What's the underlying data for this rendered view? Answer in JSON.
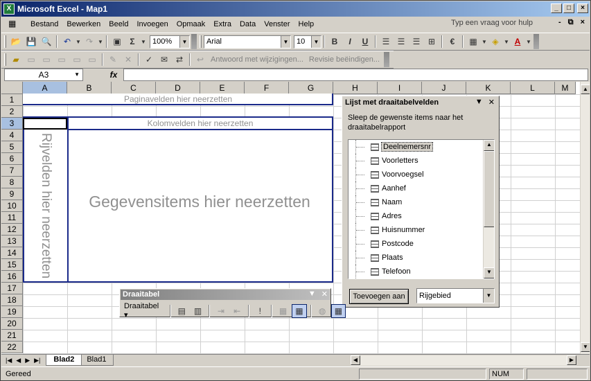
{
  "window": {
    "title": "Microsoft Excel - Map1",
    "minimize": "_",
    "maximize": "□",
    "close": "×"
  },
  "menu": {
    "items": [
      "Bestand",
      "Bewerken",
      "Beeld",
      "Invoegen",
      "Opmaak",
      "Extra",
      "Data",
      "Venster",
      "Help"
    ],
    "ask_placeholder": "Typ een vraag voor hulp"
  },
  "toolbar": {
    "zoom": "100%",
    "font": "Arial",
    "font_size": "10",
    "bold": "B",
    "italic": "I",
    "underline": "U",
    "euro": "€",
    "reply_with_changes": "Antwoord met wijzigingen...",
    "end_review": "Revisie beëindigen..."
  },
  "formula": {
    "namebox": "A3",
    "fx": "fx",
    "value": ""
  },
  "grid": {
    "columns": [
      "A",
      "B",
      "C",
      "D",
      "E",
      "F",
      "G",
      "H",
      "I",
      "J",
      "K",
      "L",
      "M"
    ],
    "rows": [
      "1",
      "2",
      "3",
      "4",
      "5",
      "6",
      "7",
      "8",
      "9",
      "10",
      "11",
      "12",
      "13",
      "14",
      "15",
      "16",
      "17",
      "18",
      "19",
      "20",
      "21",
      "22"
    ],
    "selected_column": "A",
    "selected_row": "3"
  },
  "pivot_layout": {
    "page_fields": "Paginavelden hier neerzetten",
    "column_fields": "Kolomvelden hier neerzetten",
    "row_fields": "Rijvelden hier neerzetten",
    "data_items": "Gegevensitems hier neerzetten"
  },
  "field_list": {
    "title": "Lijst met draaitabelvelden",
    "instructions": "Sleep de gewenste items naar het draaitabelrapport",
    "fields": [
      "Deelnemersnr",
      "Voorletters",
      "Voorvoegsel",
      "Aanhef",
      "Naam",
      "Adres",
      "Huisnummer",
      "Postcode",
      "Plaats",
      "Telefoon"
    ],
    "selected_field": "Deelnemersnr",
    "add_button": "Toevoegen aan",
    "area": "Rijgebied"
  },
  "pivot_toolbar": {
    "title": "Draaitabel",
    "menu": "Draaitabel"
  },
  "sheets": {
    "tabs": [
      "Blad2",
      "Blad1"
    ],
    "active": "Blad2"
  },
  "status": {
    "text": "Gereed",
    "num": "NUM"
  },
  "colors": {
    "title_start": "#0a246a",
    "title_end": "#a6caf0",
    "pivot_border": "#1a2a8a",
    "chrome": "#d4d0c8"
  }
}
